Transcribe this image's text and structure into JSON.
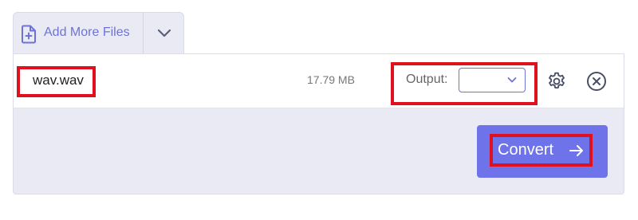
{
  "toolbar": {
    "add_files_label": "Add More Files"
  },
  "file": {
    "name": "wav.wav",
    "size": "17.79 MB",
    "output_label": "Output:",
    "output_value": ""
  },
  "actions": {
    "convert_label": "Convert"
  },
  "colors": {
    "accent": "#6d73d6",
    "convert_bg": "#6f73ea",
    "highlight": "#e0101e",
    "panel_bg": "#e9eaf3"
  },
  "icons": [
    "file-plus-icon",
    "chevron-down-icon",
    "gear-icon",
    "close-circle-icon",
    "arrow-right-icon"
  ]
}
